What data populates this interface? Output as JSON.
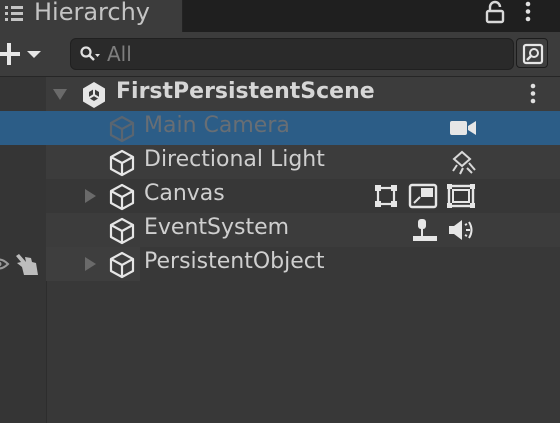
{
  "panel": {
    "title": "Hierarchy"
  },
  "search": {
    "placeholder": "All"
  },
  "hierarchy": {
    "scene": "FirstPersistentScene",
    "items": [
      {
        "label": "Main Camera"
      },
      {
        "label": "Directional Light"
      },
      {
        "label": "Canvas"
      },
      {
        "label": "EventSystem"
      },
      {
        "label": "PersistentObject"
      }
    ]
  },
  "colors": {
    "selection": "#2c5d87",
    "text": "#cfcfcf",
    "icon": "#e6e6e6",
    "background": "#383838"
  },
  "icons": {
    "tab": "list-icon",
    "lock": "lock-icon",
    "menu": "kebab-menu-icon",
    "add": "plus-icon",
    "search": "search-icon",
    "scene": "unity-logo-icon",
    "gameobject": "cube-icon",
    "camera": "camera-icon",
    "light": "directional-light-icon",
    "canvas": [
      "rect-transform-icon",
      "canvas-scaler-icon",
      "graphic-raycaster-icon"
    ],
    "eventsystem": [
      "event-system-icon",
      "input-module-icon"
    ],
    "visibility": "eye-icon",
    "picking": "hand-pointer-icon"
  }
}
